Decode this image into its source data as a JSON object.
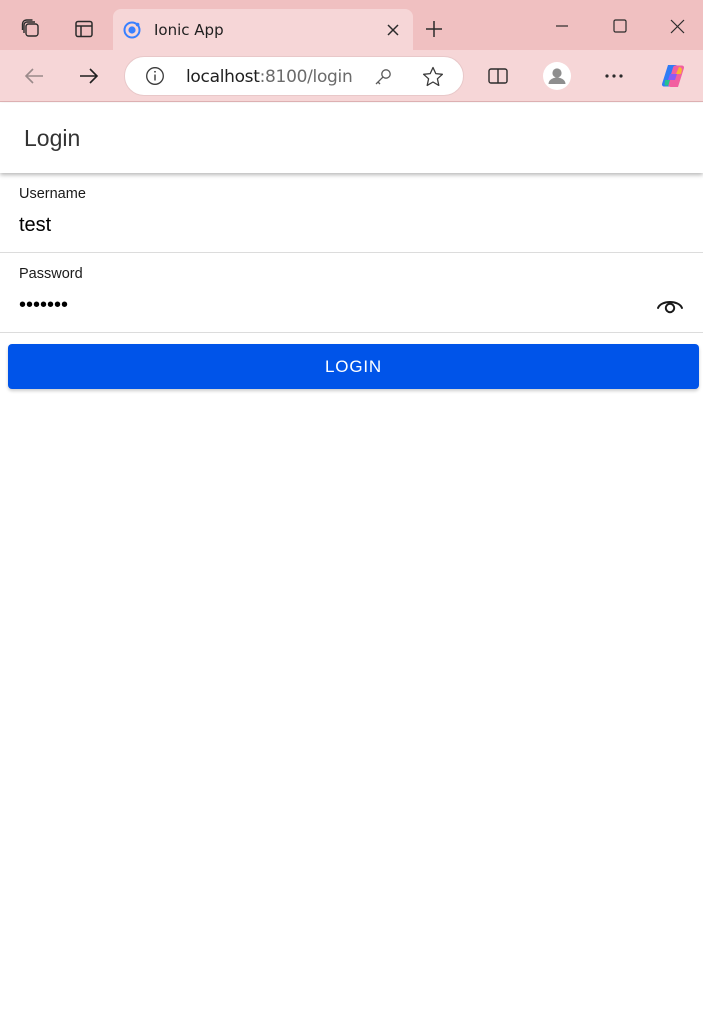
{
  "browser": {
    "tab_title": "Ionic App",
    "url_host": "localhost",
    "url_rest": ":8100/login"
  },
  "icons": {
    "workspaces": "workspaces-icon",
    "tab_actions": "tab-actions-icon",
    "new_tab": "plus-icon",
    "back": "arrow-left-icon",
    "forward": "arrow-right-icon",
    "info": "info-icon",
    "key": "key-icon",
    "favorite": "star-icon",
    "split": "split-screen-icon",
    "profile": "profile-icon",
    "more": "more-icon",
    "copilot": "copilot-icon",
    "eye": "eye-icon"
  },
  "app": {
    "title": "Login",
    "username": {
      "label": "Username",
      "value": "test"
    },
    "password": {
      "label": "Password",
      "masked": "•••••••"
    },
    "login_label": "LOGIN"
  },
  "colors": {
    "primary": "#0054e9",
    "chrome": "#f6d6d7",
    "tabbar": "#f0c0c1"
  }
}
